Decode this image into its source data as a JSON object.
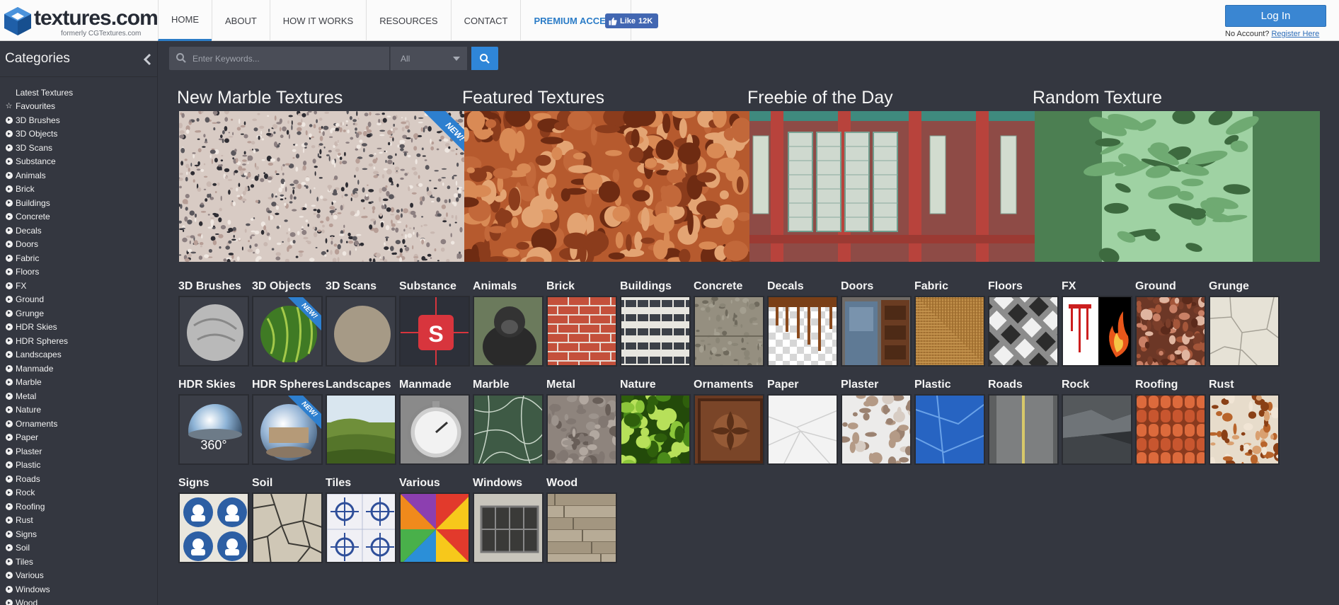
{
  "header": {
    "logo_name": "textures.com",
    "logo_sub": "formerly CGTextures.com",
    "nav": [
      "HOME",
      "ABOUT",
      "HOW IT WORKS",
      "RESOURCES",
      "CONTACT",
      "PREMIUM ACCESS"
    ],
    "active_nav": "HOME",
    "fb_like_label": "Like",
    "fb_like_count": "12K",
    "login_label": "Log In",
    "no_account_text": "No Account?",
    "register_label": "Register Here"
  },
  "sidebar": {
    "title": "Categories",
    "items": [
      {
        "label": "Latest Textures",
        "icon": "none"
      },
      {
        "label": "Favourites",
        "icon": "star-icon"
      },
      {
        "label": "3D Brushes",
        "icon": "arrow-circle-icon"
      },
      {
        "label": "3D Objects",
        "icon": "arrow-circle-icon"
      },
      {
        "label": "3D Scans",
        "icon": "arrow-circle-icon"
      },
      {
        "label": "Substance",
        "icon": "arrow-circle-icon"
      },
      {
        "label": "Animals",
        "icon": "arrow-circle-icon"
      },
      {
        "label": "Brick",
        "icon": "arrow-circle-icon"
      },
      {
        "label": "Buildings",
        "icon": "arrow-circle-icon"
      },
      {
        "label": "Concrete",
        "icon": "arrow-circle-icon"
      },
      {
        "label": "Decals",
        "icon": "arrow-circle-icon"
      },
      {
        "label": "Doors",
        "icon": "arrow-circle-icon"
      },
      {
        "label": "Fabric",
        "icon": "arrow-circle-icon"
      },
      {
        "label": "Floors",
        "icon": "arrow-circle-icon"
      },
      {
        "label": "FX",
        "icon": "arrow-circle-icon"
      },
      {
        "label": "Ground",
        "icon": "arrow-circle-icon"
      },
      {
        "label": "Grunge",
        "icon": "arrow-circle-icon"
      },
      {
        "label": "HDR Skies",
        "icon": "arrow-circle-icon"
      },
      {
        "label": "HDR Spheres",
        "icon": "arrow-circle-icon"
      },
      {
        "label": "Landscapes",
        "icon": "arrow-circle-icon"
      },
      {
        "label": "Manmade",
        "icon": "arrow-circle-icon"
      },
      {
        "label": "Marble",
        "icon": "arrow-circle-icon"
      },
      {
        "label": "Metal",
        "icon": "arrow-circle-icon"
      },
      {
        "label": "Nature",
        "icon": "arrow-circle-icon"
      },
      {
        "label": "Ornaments",
        "icon": "arrow-circle-icon"
      },
      {
        "label": "Paper",
        "icon": "arrow-circle-icon"
      },
      {
        "label": "Plaster",
        "icon": "arrow-circle-icon"
      },
      {
        "label": "Plastic",
        "icon": "arrow-circle-icon"
      },
      {
        "label": "Roads",
        "icon": "arrow-circle-icon"
      },
      {
        "label": "Rock",
        "icon": "arrow-circle-icon"
      },
      {
        "label": "Roofing",
        "icon": "arrow-circle-icon"
      },
      {
        "label": "Rust",
        "icon": "arrow-circle-icon"
      },
      {
        "label": "Signs",
        "icon": "arrow-circle-icon"
      },
      {
        "label": "Soil",
        "icon": "arrow-circle-icon"
      },
      {
        "label": "Tiles",
        "icon": "arrow-circle-icon"
      },
      {
        "label": "Various",
        "icon": "arrow-circle-icon"
      },
      {
        "label": "Windows",
        "icon": "arrow-circle-icon"
      },
      {
        "label": "Wood",
        "icon": "arrow-circle-icon"
      }
    ]
  },
  "search": {
    "placeholder": "Enter Keywords...",
    "filter_value": "All"
  },
  "featured": [
    {
      "title": "New Marble Textures",
      "texture": "granite",
      "ribbon": "NEW!"
    },
    {
      "title": "Featured Textures",
      "texture": "rust-rock",
      "ribbon": ""
    },
    {
      "title": "Freebie of the Day",
      "texture": "window-screen",
      "ribbon": ""
    },
    {
      "title": "Random Texture",
      "texture": "camo",
      "ribbon": ""
    }
  ],
  "categories_grid": [
    [
      {
        "label": "3D Brushes",
        "texture": "brush-sphere",
        "ribbon": ""
      },
      {
        "label": "3D Objects",
        "texture": "watermelon",
        "ribbon": "NEW!"
      },
      {
        "label": "3D Scans",
        "texture": "scan-sphere",
        "ribbon": ""
      },
      {
        "label": "Substance",
        "texture": "substance-logo",
        "ribbon": ""
      },
      {
        "label": "Animals",
        "texture": "gorilla",
        "ribbon": ""
      },
      {
        "label": "Brick",
        "texture": "brick",
        "ribbon": ""
      },
      {
        "label": "Buildings",
        "texture": "building",
        "ribbon": ""
      },
      {
        "label": "Concrete",
        "texture": "concrete",
        "ribbon": ""
      },
      {
        "label": "Decals",
        "texture": "decal-drips",
        "ribbon": ""
      },
      {
        "label": "Doors",
        "texture": "doors",
        "ribbon": ""
      },
      {
        "label": "Fabric",
        "texture": "burlap",
        "ribbon": ""
      },
      {
        "label": "Floors",
        "texture": "checker",
        "ribbon": ""
      },
      {
        "label": "FX",
        "texture": "fx-blood-fire",
        "ribbon": ""
      },
      {
        "label": "Ground",
        "texture": "gravel",
        "ribbon": ""
      },
      {
        "label": "Grunge",
        "texture": "cracked-paint",
        "ribbon": ""
      }
    ],
    [
      {
        "label": "HDR Skies",
        "texture": "hdr-sky",
        "ribbon": "",
        "badge": "360°"
      },
      {
        "label": "HDR Spheres",
        "texture": "hdr-sphere",
        "ribbon": "NEW!"
      },
      {
        "label": "Landscapes",
        "texture": "landscape",
        "ribbon": ""
      },
      {
        "label": "Manmade",
        "texture": "gauge",
        "ribbon": ""
      },
      {
        "label": "Marble",
        "texture": "green-marble",
        "ribbon": ""
      },
      {
        "label": "Metal",
        "texture": "metal",
        "ribbon": ""
      },
      {
        "label": "Nature",
        "texture": "ivy",
        "ribbon": ""
      },
      {
        "label": "Ornaments",
        "texture": "ornament",
        "ribbon": ""
      },
      {
        "label": "Paper",
        "texture": "crumpled-paper",
        "ribbon": ""
      },
      {
        "label": "Plaster",
        "texture": "plaster",
        "ribbon": ""
      },
      {
        "label": "Plastic",
        "texture": "blue-plastic",
        "ribbon": ""
      },
      {
        "label": "Roads",
        "texture": "road",
        "ribbon": ""
      },
      {
        "label": "Rock",
        "texture": "rock",
        "ribbon": ""
      },
      {
        "label": "Roofing",
        "texture": "roof-tiles",
        "ribbon": ""
      },
      {
        "label": "Rust",
        "texture": "rust",
        "ribbon": ""
      }
    ],
    [
      {
        "label": "Signs",
        "texture": "safety-signs",
        "ribbon": ""
      },
      {
        "label": "Soil",
        "texture": "dry-soil",
        "ribbon": ""
      },
      {
        "label": "Tiles",
        "texture": "azulejo",
        "ribbon": ""
      },
      {
        "label": "Various",
        "texture": "umbrella",
        "ribbon": ""
      },
      {
        "label": "Windows",
        "texture": "window",
        "ribbon": ""
      },
      {
        "label": "Wood",
        "texture": "wood-planks",
        "ribbon": ""
      }
    ]
  ],
  "colors": {
    "accent": "#2f86d8",
    "page_bg": "#343740",
    "header_bg": "#fbfbfb"
  }
}
